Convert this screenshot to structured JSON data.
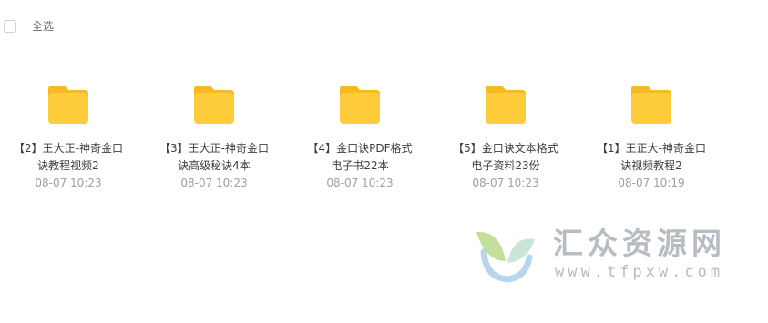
{
  "toolbar": {
    "select_all_label": "全选"
  },
  "files": [
    {
      "name": "【2】王大正-神奇金口诀教程视频2",
      "time": "08-07 10:23",
      "icon": "folder-icon"
    },
    {
      "name": "【3】王大正-神奇金口诀高级秘诀4本",
      "time": "08-07 10:23",
      "icon": "folder-icon"
    },
    {
      "name": "【4】金口诀PDF格式电子书22本",
      "time": "08-07 10:23",
      "icon": "folder-icon"
    },
    {
      "name": "【5】金口诀文本格式电子资料23份",
      "time": "08-07 10:23",
      "icon": "folder-icon"
    },
    {
      "name": "【1】王正大-神奇金口诀视频教程2",
      "time": "08-07 10:19",
      "icon": "folder-icon"
    }
  ],
  "watermark": {
    "title": "汇众资源网",
    "url": "www.tfpxw.com"
  },
  "colors": {
    "folder_body": "#ffcd3c",
    "folder_tab": "#f7b924",
    "time_text": "#9aa0a8",
    "watermark_text": "#b7bcc2"
  }
}
